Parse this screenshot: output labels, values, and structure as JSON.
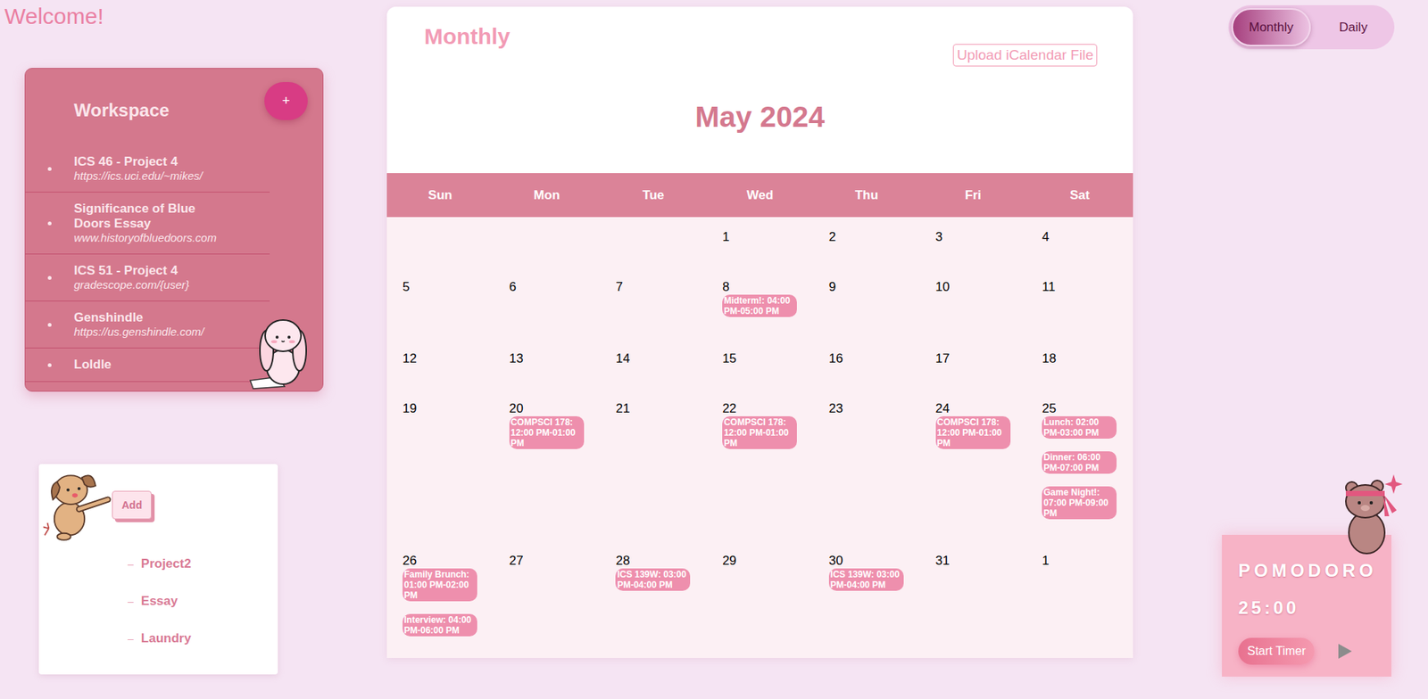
{
  "welcome": "Welcome!",
  "workspace": {
    "title": "Workspace",
    "add_button": "+",
    "items": [
      {
        "title": "ICS 46 - Project 4",
        "url": "https://ics.uci.edu/~mikes/"
      },
      {
        "title": "Significance of Blue Doors Essay",
        "url": "www.historyofbluedoors.com"
      },
      {
        "title": "ICS 51 - Project 4",
        "url": "gradescope.com/{user}"
      },
      {
        "title": "Genshindle",
        "url": "https://us.genshindle.com/"
      },
      {
        "title": "Loldle",
        "url": ""
      }
    ]
  },
  "todo": {
    "add_button": "Add",
    "marker": "–",
    "items": [
      "Project2",
      "Essay",
      "Laundry"
    ]
  },
  "calendar": {
    "title": "Monthly",
    "upload_button": "Upload iCalendar File",
    "month": "May 2024",
    "weekdays": [
      "Sun",
      "Mon",
      "Tue",
      "Wed",
      "Thu",
      "Fri",
      "Sat"
    ],
    "weeks": [
      [
        {
          "day": "",
          "events": []
        },
        {
          "day": "",
          "events": []
        },
        {
          "day": "",
          "events": []
        },
        {
          "day": "1",
          "events": []
        },
        {
          "day": "2",
          "events": []
        },
        {
          "day": "3",
          "events": []
        },
        {
          "day": "4",
          "events": []
        }
      ],
      [
        {
          "day": "5",
          "events": []
        },
        {
          "day": "6",
          "events": []
        },
        {
          "day": "7",
          "events": []
        },
        {
          "day": "8",
          "events": [
            "Midterm!: 04:00 PM-05:00 PM"
          ]
        },
        {
          "day": "9",
          "events": []
        },
        {
          "day": "10",
          "events": []
        },
        {
          "day": "11",
          "events": []
        }
      ],
      [
        {
          "day": "12",
          "events": []
        },
        {
          "day": "13",
          "events": []
        },
        {
          "day": "14",
          "events": []
        },
        {
          "day": "15",
          "events": []
        },
        {
          "day": "16",
          "events": []
        },
        {
          "day": "17",
          "events": []
        },
        {
          "day": "18",
          "events": []
        }
      ],
      [
        {
          "day": "19",
          "events": []
        },
        {
          "day": "20",
          "events": [
            "COMPSCI 178: 12:00 PM-01:00 PM"
          ]
        },
        {
          "day": "21",
          "events": []
        },
        {
          "day": "22",
          "events": [
            "COMPSCI 178: 12:00 PM-01:00 PM"
          ]
        },
        {
          "day": "23",
          "events": []
        },
        {
          "day": "24",
          "events": [
            "COMPSCI 178: 12:00 PM-01:00 PM"
          ]
        },
        {
          "day": "25",
          "events": [
            "Lunch: 02:00 PM-03:00 PM",
            "Dinner: 06:00 PM-07:00 PM",
            "Game Night!: 07:00 PM-09:00 PM"
          ]
        }
      ],
      [
        {
          "day": "26",
          "events": [
            "Family Brunch: 01:00 PM-02:00 PM",
            "Interview: 04:00 PM-06:00 PM"
          ]
        },
        {
          "day": "27",
          "events": []
        },
        {
          "day": "28",
          "events": [
            "ICS 139W: 03:00 PM-04:00 PM"
          ]
        },
        {
          "day": "29",
          "events": []
        },
        {
          "day": "30",
          "events": [
            "ICS 139W: 03:00 PM-04:00 PM"
          ]
        },
        {
          "day": "31",
          "events": []
        },
        {
          "day": "1",
          "events": []
        }
      ]
    ]
  },
  "view_toggle": [
    {
      "label": "Monthly",
      "selected": true
    },
    {
      "label": "Daily",
      "selected": false
    }
  ],
  "pomodoro": {
    "title": "POMODORO",
    "time": "25:00",
    "start_button": "Start Timer"
  }
}
